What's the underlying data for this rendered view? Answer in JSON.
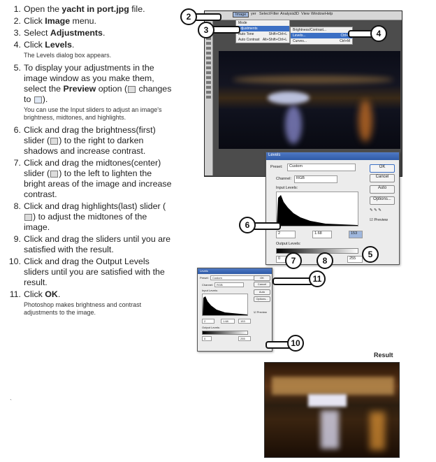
{
  "steps": [
    {
      "num": "1.",
      "parts": [
        "Open the ",
        "yacht in port.jpg",
        " file."
      ],
      "note": ""
    },
    {
      "num": "2.",
      "parts": [
        "Click ",
        "Image",
        " menu."
      ],
      "note": ""
    },
    {
      "num": "3.",
      "parts": [
        "Select ",
        "Adjustments",
        "."
      ],
      "note": ""
    },
    {
      "num": "4.",
      "parts": [
        "Click ",
        "Levels",
        "."
      ],
      "note": "The Levels dialog box appears."
    },
    {
      "num": "5.",
      "text": "To display your adjustments in the image window as you make them, select the ",
      "bold": "Preview",
      "text2": " option (",
      "text3": " changes to ",
      "text4": ").",
      "note": "You can use the Input sliders to adjust an image's brightness, midtones, and highlights."
    },
    {
      "num": "6.",
      "text": "Click and drag the brightness(first) slider (",
      "text2": ") to the right to darken shadows and increase contrast.",
      "note": ""
    },
    {
      "num": "7.",
      "text": "Click and drag the midtones(center) slider (",
      "text2": ") to the left to lighten the bright areas of the image and increase contrast.",
      "note": ""
    },
    {
      "num": "8.",
      "text": "Click and drag highlights(last) slider (",
      "text2": ") to adjust the midtones of the image.",
      "note": ""
    },
    {
      "num": "9.",
      "text": "Click and drag the sliders until you are satisfied with the result.",
      "note": ""
    },
    {
      "num": "10.",
      "text": "Click and drag the Output Levels sliders until you are satisfied with the result.",
      "note": ""
    },
    {
      "num": "11.",
      "parts": [
        "Click ",
        "OK",
        "."
      ],
      "note": "Photoshop makes brightness and contrast adjustments to the image."
    }
  ],
  "menubar": [
    "Image",
    "yer",
    "Select",
    "Filter",
    "Analysis",
    "3D",
    "View",
    "Window",
    "Help"
  ],
  "image_menu": [
    "Mode",
    "Adjustments",
    "Auto Tone",
    "Auto Contrast"
  ],
  "image_menu_shortcuts": [
    "Shift+Ctrl+L",
    "Alt+Shift+Ctrl+L"
  ],
  "adjust_menu": [
    "Brightness/Contrast...",
    "Levels...",
    "Curves..."
  ],
  "adjust_shortcuts": [
    "Ctrl+L",
    "Ctrl+M"
  ],
  "badges": {
    "b2": "2",
    "b3": "3",
    "b4": "4",
    "b5": "5",
    "b6": "6",
    "b7": "7",
    "b8": "8",
    "b10": "10",
    "b11": "11"
  },
  "levels": {
    "title": "Levels",
    "preset_label": "Preset:",
    "preset_value": "Custom",
    "channel_label": "Channel:",
    "channel_value": "RGB",
    "input_label": "Input Levels:",
    "in_black": "2",
    "in_mid": "1.68",
    "in_white": "153",
    "output_label": "Output Levels:",
    "out_black": "0",
    "out_white": "255",
    "ok": "OK",
    "cancel": "Cancel",
    "auto": "Auto",
    "options": "Options...",
    "preview": "Preview"
  },
  "levels_small": {
    "title": "Levels",
    "preset_label": "Preset:",
    "preset_value": "Custom",
    "channel_label": "Channel:",
    "channel_value": "RGB",
    "input_label": "Input Levels:",
    "in_black": "2",
    "in_mid": "1.68",
    "in_white": "153",
    "output_label": "Output Levels:",
    "out_black": "0",
    "out_white": "255",
    "ok": "OK",
    "cancel": "Cancel",
    "auto": "Auto",
    "options": "Options...",
    "preview": "Preview"
  },
  "result_label": "Result",
  "footer_mark": "`"
}
